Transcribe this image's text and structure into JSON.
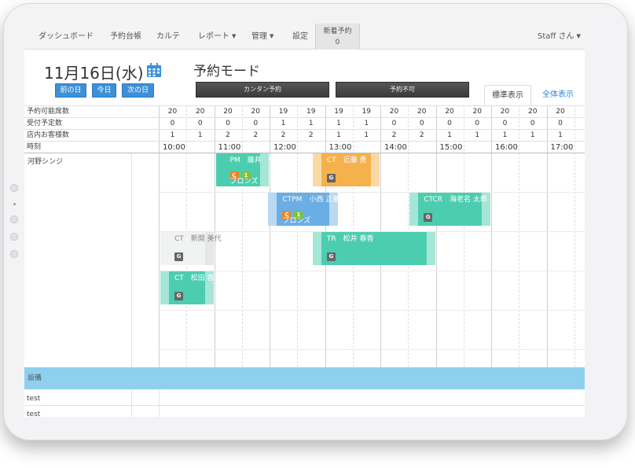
{
  "nav": {
    "items": [
      {
        "label": "ダッシュボード",
        "dropdown": false
      },
      {
        "label": "予約台帳",
        "dropdown": false
      },
      {
        "label": "カルテ",
        "dropdown": false
      },
      {
        "label": "レポート",
        "dropdown": true
      },
      {
        "label": "管理",
        "dropdown": true
      },
      {
        "label": "設定",
        "dropdown": false
      }
    ],
    "new_reservation": {
      "label": "新着予約",
      "count": "0"
    },
    "user": "Staff さん"
  },
  "header": {
    "date": "11月16日(水)",
    "prev_day": "前の日",
    "today": "今日",
    "next_day": "次の日",
    "mode_title": "予約モード",
    "easy_booking": "カンタン予約",
    "unavailable": "予約不可",
    "tab_standard": "標準表示",
    "tab_all": "全体表示"
  },
  "grid": {
    "row_labels": {
      "available": "予約可能席数",
      "scheduled": "受付予定数",
      "in_store": "店内お客様数",
      "time": "時刻"
    },
    "available": [
      "20",
      "20",
      "20",
      "20",
      "19",
      "19",
      "19",
      "19",
      "20",
      "20",
      "20",
      "20",
      "20",
      "20",
      "20"
    ],
    "scheduled": [
      "0",
      "0",
      "0",
      "0",
      "1",
      "1",
      "1",
      "1",
      "0",
      "0",
      "0",
      "0",
      "0",
      "0",
      "0"
    ],
    "in_store": [
      "1",
      "1",
      "2",
      "2",
      "2",
      "2",
      "1",
      "1",
      "2",
      "2",
      "1",
      "1",
      "1",
      "1",
      "1"
    ],
    "times": [
      "10:00",
      "11:00",
      "12:00",
      "13:00",
      "14:00",
      "15:00",
      "16:00",
      "17:00"
    ],
    "staff": "河野シンジ",
    "equipment_label": "設備",
    "equipment_rows": [
      "test",
      "test"
    ]
  },
  "bookings": [
    {
      "id": "b1",
      "menu": "PM",
      "customer": "藤井　誠",
      "rank": "ブロンズ",
      "badges": [
        "C",
        "1"
      ],
      "g": false,
      "color": "#4dcdb0",
      "side": "#a6e6d6",
      "side_pos": "right",
      "start": 11.0,
      "end": 12.0,
      "lane": 0
    },
    {
      "id": "b2",
      "menu": "CT",
      "customer": "近藤 勇",
      "rank": "",
      "badges": [],
      "g": true,
      "color": "#f5b14c",
      "side": "#fbd9a4",
      "side_pos": "both",
      "start": 12.75,
      "end": 14.0,
      "lane": 0
    },
    {
      "id": "b3",
      "menu": "CTPM",
      "customer": "小西 正義",
      "rank": "ブロンズ",
      "badges": [
        "C",
        "1"
      ],
      "g": false,
      "color": "#6aaee5",
      "side": "#b9d9f3",
      "side_pos": "both",
      "start": 11.95,
      "end": 13.25,
      "lane": 1
    },
    {
      "id": "b4",
      "menu": "CTCR",
      "customer": "海老名 太郎",
      "rank": "",
      "badges": [],
      "g": true,
      "color": "#4dcdb0",
      "side": "#a6e6d6",
      "side_pos": "both",
      "start": 14.5,
      "end": 16.0,
      "lane": 1
    },
    {
      "id": "b5",
      "menu": "CT",
      "customer": "新開 美代",
      "rank": "",
      "badges": [],
      "g": true,
      "color": "#f1f2f2",
      "side": "#e6e8e8",
      "side_pos": "right",
      "start": 10.0,
      "end": 11.0,
      "lane": 2,
      "text_color": "#888"
    },
    {
      "id": "b6",
      "menu": "TR",
      "customer": "松井 春香",
      "rank": "",
      "badges": [],
      "g": true,
      "color": "#4dcdb0",
      "side": "#a6e6d6",
      "side_pos": "both",
      "start": 12.75,
      "end": 15.0,
      "lane": 2
    },
    {
      "id": "b7",
      "menu": "CT",
      "customer": "松田 香",
      "rank": "",
      "badges": [],
      "g": true,
      "color": "#4dcdb0",
      "side": "#a6e6d6",
      "side_pos": "both",
      "start": 10.0,
      "end": 11.0,
      "lane": 3
    }
  ],
  "colors": {
    "accent": "#3d90d8",
    "teal": "#4dcdb0",
    "orange": "#f5b14c",
    "blue": "#6aaee5",
    "equipment": "#8fd0ef"
  }
}
